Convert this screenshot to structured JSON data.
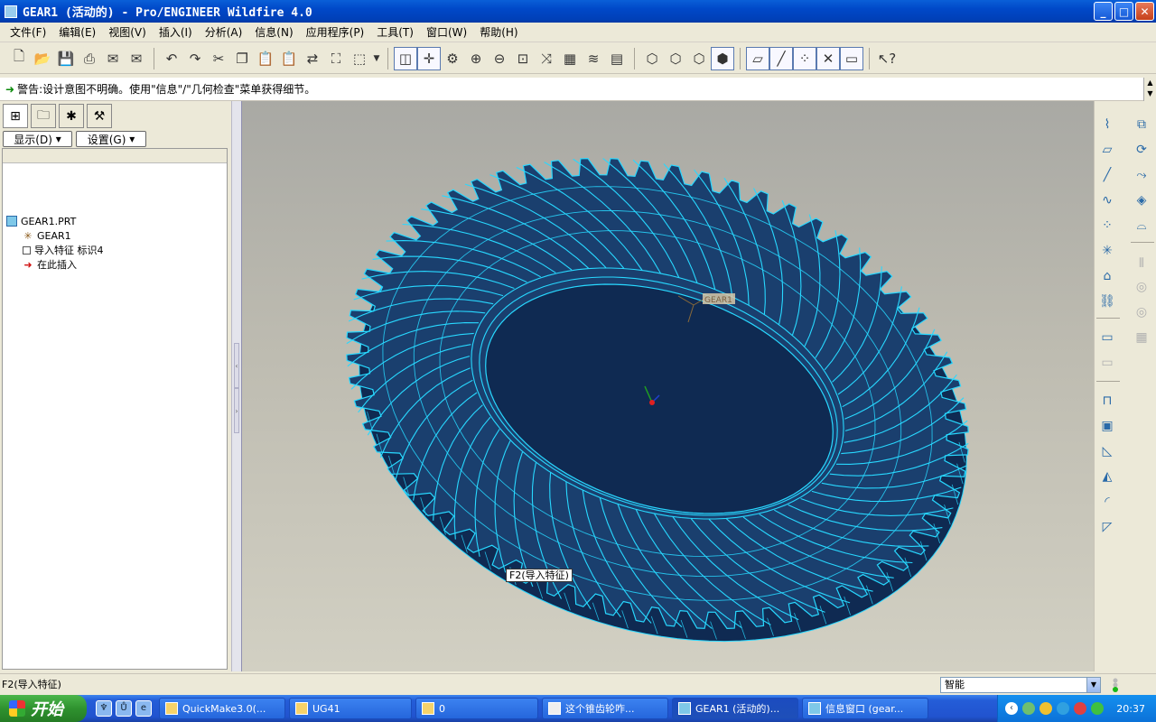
{
  "window": {
    "title": "GEAR1 (活动的) - Pro/ENGINEER Wildfire 4.0",
    "controls": {
      "minimize": "_",
      "maximize": "□",
      "close": "✕"
    }
  },
  "menu": [
    "文件(F)",
    "编辑(E)",
    "视图(V)",
    "插入(I)",
    "分析(A)",
    "信息(N)",
    "应用程序(P)",
    "工具(T)",
    "窗口(W)",
    "帮助(H)"
  ],
  "toolbar": {
    "groups": [
      [
        "new-file-icon",
        "open-file-icon",
        "save-icon",
        "print-icon",
        "send-mail-icon",
        "mail-attach-icon"
      ],
      [
        "undo-icon",
        "redo-icon",
        "cut-icon",
        "copy-icon",
        "paste-icon",
        "paste-special-icon",
        "regenerate-icon",
        "find-icon",
        "select-box-icon",
        "dropdown-arrow-icon"
      ],
      [
        "repaint-icon",
        "spin-center-icon",
        "orient-mode-icon",
        "zoom-in-icon",
        "zoom-out-icon",
        "refit-icon",
        "reorient-icon",
        "saved-views-icon",
        "layers-icon",
        "view-manager-icon"
      ],
      [
        "wireframe-icon",
        "hidden-line-icon",
        "no-hidden-icon",
        "shading-icon"
      ],
      [
        "datum-planes-icon",
        "datum-axes-icon",
        "datum-points-icon",
        "coordinate-systems-icon",
        "annotations-icon"
      ],
      [
        "context-help-icon"
      ]
    ]
  },
  "message": {
    "icon": "green-arrow-icon",
    "text": "警告:设计意图不明确。使用\"信息\"/\"几何检查\"菜单获得细节。"
  },
  "model_tree": {
    "display_button": "显示(D)",
    "settings_button": "设置(G)",
    "items": [
      {
        "label": "GEAR1.PRT",
        "icon": "part-icon",
        "indent": 0
      },
      {
        "label": "GEAR1",
        "icon": "coordinate-system-icon",
        "indent": 1
      },
      {
        "label": "导入特征 标识4",
        "icon": "import-feature-icon",
        "indent": 1
      },
      {
        "label": "在此插入",
        "icon": "insert-here-arrow-icon",
        "indent": 1
      }
    ]
  },
  "graphics": {
    "csys_label": "GEAR1",
    "tooltip": "F2(导入特征)",
    "model": "spiral bevel gear"
  },
  "right_toolbar": [
    "sketch-tool-icon",
    "datum-plane-icon",
    "datum-axis-icon",
    "datum-curve-icon",
    "datum-point-icon",
    "coordinate-system-icon",
    "analysis-feature-icon",
    "link-icon",
    "extrude-icon",
    "revolve-icon",
    "sweep-icon",
    "blend-icon",
    "mirror-icon",
    "merge-icon",
    "trim-icon",
    "offset-icon",
    "thicken-icon",
    "pattern-icon",
    "hole-icon",
    "shell-icon",
    "rib-icon",
    "draft-icon",
    "round-icon",
    "chamfer-icon"
  ],
  "status": {
    "text": "F2(导入特征)",
    "filter": "智能"
  },
  "taskbar": {
    "start": "开始",
    "tasks": [
      "QuickMake3.0(...",
      "UG41",
      "0",
      "这个锥齿轮咋...",
      "GEAR1 (活动的)...",
      "信息窗口 (gear..."
    ],
    "active_task": 4,
    "clock": "20:37"
  },
  "colors": {
    "gear_fill": "#1a3f6e",
    "gear_edges": "#28d8ff",
    "background_top": "#a9a9a4",
    "background_bottom": "#d2d0c3",
    "titlebar": "#0048c8"
  }
}
